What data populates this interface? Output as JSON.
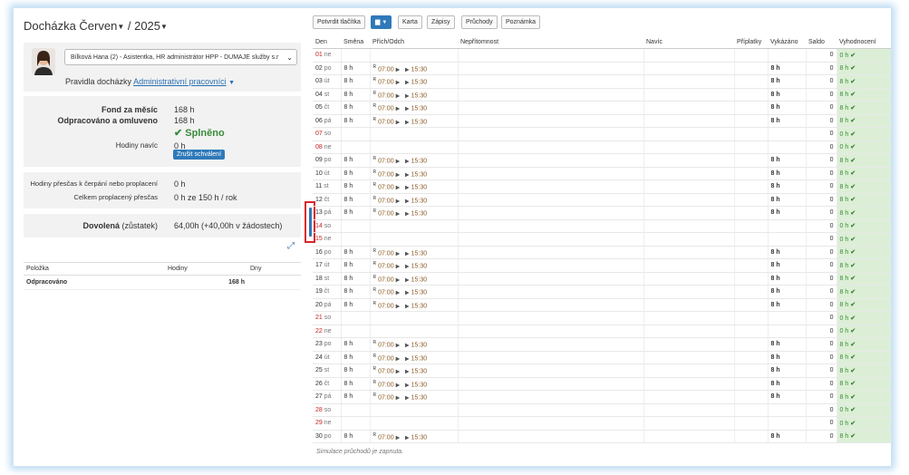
{
  "header": {
    "title_month": "Docházka Červen",
    "title_sep": " / ",
    "title_year": "2025"
  },
  "user": {
    "selected": "Bílková Hana (2) - Asistentka, HR administrátor HPP - DUMAJE služby s.r",
    "rules_label": "Pravidla docházky",
    "rules_link": "Administrativní pracovníci"
  },
  "summary": {
    "fund_label": "Fond za měsíc",
    "fund_value": "168 h",
    "worked_label": "Odpracováno a omluveno",
    "worked_value": "168 h",
    "status": "Splněno",
    "extra_label": "Hodiny navíc",
    "extra_value": "0 h",
    "cancel_button": "Zrušit schválení"
  },
  "overtime": {
    "left_label": "Hodiny přesčas k čerpání nebo proplacení",
    "left_value": "0 h",
    "paid_label": "Celkem proplacený přesčas",
    "paid_value": "0 h ze 150 h / rok"
  },
  "vacation": {
    "label_bold": "Dovolená",
    "label_rest": " (zůstatek)",
    "value": "64,00h (+40,00h v žádostech)"
  },
  "items_table": {
    "headers": [
      "Položka",
      "Hodiny",
      "Dny"
    ],
    "rows": [
      {
        "item": "Odpracováno",
        "hours": "168 h",
        "days": ""
      }
    ]
  },
  "toolbar": {
    "confirm": "Potvrdit tlačítka",
    "card": "Karta",
    "records": "Zápisy",
    "passes": "Průchody",
    "note": "Poznámka"
  },
  "grid": {
    "headers": [
      "Den",
      "Směna",
      "Přích/Odch",
      "Nepřítomnost",
      "Navíc",
      "Příplatky",
      "Vykázáno",
      "Saldo",
      "Vyhodnocení"
    ],
    "rows": [
      {
        "day": "01",
        "dow": "ne",
        "weekend": true
      },
      {
        "day": "02",
        "dow": "po",
        "weekend": false
      },
      {
        "day": "03",
        "dow": "út",
        "weekend": false
      },
      {
        "day": "04",
        "dow": "st",
        "weekend": false
      },
      {
        "day": "05",
        "dow": "čt",
        "weekend": false
      },
      {
        "day": "06",
        "dow": "pá",
        "weekend": false
      },
      {
        "day": "07",
        "dow": "so",
        "weekend": true
      },
      {
        "day": "08",
        "dow": "ne",
        "weekend": true
      },
      {
        "day": "09",
        "dow": "po",
        "weekend": false
      },
      {
        "day": "10",
        "dow": "út",
        "weekend": false
      },
      {
        "day": "11",
        "dow": "st",
        "weekend": false
      },
      {
        "day": "12",
        "dow": "čt",
        "weekend": false
      },
      {
        "day": "13",
        "dow": "pá",
        "weekend": false
      },
      {
        "day": "14",
        "dow": "so",
        "weekend": true
      },
      {
        "day": "15",
        "dow": "ne",
        "weekend": true
      },
      {
        "day": "16",
        "dow": "po",
        "weekend": false
      },
      {
        "day": "17",
        "dow": "út",
        "weekend": false
      },
      {
        "day": "18",
        "dow": "st",
        "weekend": false
      },
      {
        "day": "19",
        "dow": "čt",
        "weekend": false
      },
      {
        "day": "20",
        "dow": "pá",
        "weekend": false
      },
      {
        "day": "21",
        "dow": "so",
        "weekend": true
      },
      {
        "day": "22",
        "dow": "ne",
        "weekend": true
      },
      {
        "day": "23",
        "dow": "po",
        "weekend": false
      },
      {
        "day": "24",
        "dow": "út",
        "weekend": false
      },
      {
        "day": "25",
        "dow": "st",
        "weekend": false
      },
      {
        "day": "26",
        "dow": "čt",
        "weekend": false
      },
      {
        "day": "27",
        "dow": "pá",
        "weekend": false
      },
      {
        "day": "28",
        "dow": "so",
        "weekend": true
      },
      {
        "day": "29",
        "dow": "ne",
        "weekend": true
      },
      {
        "day": "30",
        "dow": "po",
        "weekend": false
      }
    ],
    "workday": {
      "shift": "8 h",
      "flag": "R",
      "in": "07:00",
      "out": "15:30",
      "reported": "8 h",
      "saldo": "0",
      "eval": "0 h",
      "eval_work": "8 h"
    }
  },
  "footer_note": "Simulace průchodů je zapnuta.",
  "colors": {
    "accent": "#2f79b9",
    "weekend": "#c91f1f",
    "ok": "#3a8a3a",
    "eval_bg": "#dcefd6",
    "highlight": "#d9262c"
  }
}
